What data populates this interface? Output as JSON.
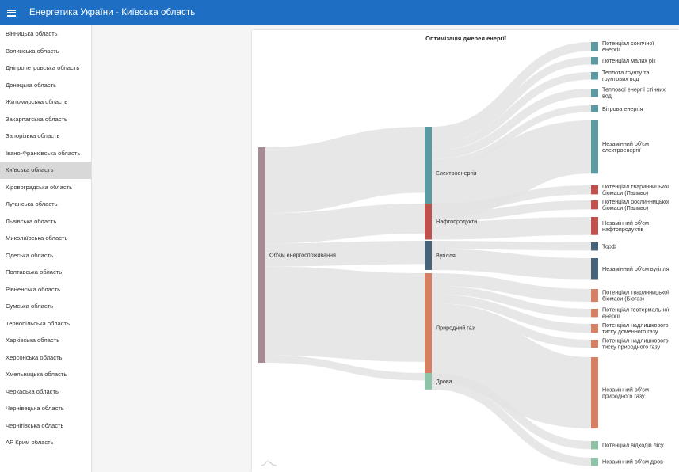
{
  "header": {
    "menu_icon": "hamburger-menu-icon",
    "title": "Енергетика України - Київська область"
  },
  "sidebar": {
    "items": [
      {
        "label": "Вінницька область",
        "active": false
      },
      {
        "label": "Волинська область",
        "active": false
      },
      {
        "label": "Дніпропетровська область",
        "active": false
      },
      {
        "label": "Донецька область",
        "active": false
      },
      {
        "label": "Житомирська область",
        "active": false
      },
      {
        "label": "Закарпатська область",
        "active": false
      },
      {
        "label": "Запорізька область",
        "active": false
      },
      {
        "label": "Івано-Франківська область",
        "active": false
      },
      {
        "label": "Київська область",
        "active": true
      },
      {
        "label": "Кіровоградська область",
        "active": false
      },
      {
        "label": "Луганська область",
        "active": false
      },
      {
        "label": "Львівська область",
        "active": false
      },
      {
        "label": "Миколаївська область",
        "active": false
      },
      {
        "label": "Одеська область",
        "active": false
      },
      {
        "label": "Полтавська область",
        "active": false
      },
      {
        "label": "Рівненська область",
        "active": false
      },
      {
        "label": "Сумська область",
        "active": false
      },
      {
        "label": "Тернопільська область",
        "active": false
      },
      {
        "label": "Харківська область",
        "active": false
      },
      {
        "label": "Херсонська область",
        "active": false
      },
      {
        "label": "Хмельницька область",
        "active": false
      },
      {
        "label": "Черкаська область",
        "active": false
      },
      {
        "label": "Чернівецька область",
        "active": false
      },
      {
        "label": "Чернігівська область",
        "active": false
      },
      {
        "label": "АР Крим область",
        "active": false
      }
    ]
  },
  "chart": {
    "title": "Оптимізація джерел енергії",
    "footer_icon": "wave-icon"
  },
  "colors": {
    "appbar": "#1e6fc4",
    "source": "#a58b93",
    "electricity": "#5b9aa0",
    "oil": "#c0504d",
    "coal": "#46637a",
    "gas": "#d67f62",
    "wood": "#8fc3a8",
    "link": "#e3e3e3"
  },
  "chart_data": {
    "type": "sankey",
    "title": "Оптимізація джерел енергії",
    "nodes": [
      {
        "id": "total",
        "label": "Об'єм енергоспоживання",
        "color": "#a58b93"
      },
      {
        "id": "el",
        "label": "Електроенергія",
        "color": "#5b9aa0"
      },
      {
        "id": "oil",
        "label": "Нафтопродукти",
        "color": "#c0504d"
      },
      {
        "id": "coal",
        "label": "Вугілля",
        "color": "#46637a"
      },
      {
        "id": "gas",
        "label": "Природний газ",
        "color": "#d67f62"
      },
      {
        "id": "wood",
        "label": "Дрова",
        "color": "#8fc3a8"
      },
      {
        "id": "el_sun",
        "label": "Потенціал сонячної енергії",
        "color": "#5b9aa0"
      },
      {
        "id": "el_river",
        "label": "Потенціал малих рік",
        "color": "#5b9aa0"
      },
      {
        "id": "el_ground",
        "label": "Теплота грунту та грунтових вод",
        "color": "#5b9aa0"
      },
      {
        "id": "el_waste",
        "label": "Теплової енергії стічних вод",
        "color": "#5b9aa0"
      },
      {
        "id": "el_wind",
        "label": "Вітрова енергія",
        "color": "#5b9aa0"
      },
      {
        "id": "el_rest",
        "label": "Незамінний об'єм електроенергії",
        "color": "#5b9aa0"
      },
      {
        "id": "oil_animal",
        "label": "Потенціал тваринницької біомаси (Паливо)",
        "color": "#c0504d"
      },
      {
        "id": "oil_plant",
        "label": "Потенціал рослинницької біомаси (Паливо)",
        "color": "#c0504d"
      },
      {
        "id": "oil_rest",
        "label": "Незамінний об'єм нафтопродуктів",
        "color": "#c0504d"
      },
      {
        "id": "coal_peat",
        "label": "Торф",
        "color": "#46637a"
      },
      {
        "id": "coal_rest",
        "label": "Незамінний об'єм вугілля",
        "color": "#46637a"
      },
      {
        "id": "gas_biogas",
        "label": "Потенціал тваринницької біомаси (Біогаз)",
        "color": "#d67f62"
      },
      {
        "id": "gas_geo",
        "label": "Потенціал геотермальної енергії",
        "color": "#d67f62"
      },
      {
        "id": "gas_blast",
        "label": "Потенціал надлишкового тиску доменного газу",
        "color": "#d67f62"
      },
      {
        "id": "gas_natural",
        "label": "Потенціал надлишкового тиску природного газу",
        "color": "#d67f62"
      },
      {
        "id": "gas_rest",
        "label": "Незамінний об'єм природного газу",
        "color": "#d67f62"
      },
      {
        "id": "wood_waste",
        "label": "Потенціал відходів лісу",
        "color": "#8fc3a8"
      },
      {
        "id": "wood_rest",
        "label": "Незамінний об'єм дров",
        "color": "#8fc3a8"
      }
    ],
    "links": [
      {
        "source": "total",
        "target": "el",
        "value": 88
      },
      {
        "source": "total",
        "target": "oil",
        "value": 40
      },
      {
        "source": "total",
        "target": "coal",
        "value": 31
      },
      {
        "source": "total",
        "target": "gas",
        "value": 118
      },
      {
        "source": "total",
        "target": "wood",
        "value": 10
      },
      {
        "source": "el",
        "target": "el_sun",
        "value": 12
      },
      {
        "source": "el",
        "target": "el_river",
        "value": 10
      },
      {
        "source": "el",
        "target": "el_ground",
        "value": 10
      },
      {
        "source": "el",
        "target": "el_waste",
        "value": 11
      },
      {
        "source": "el",
        "target": "el_wind",
        "value": 9
      },
      {
        "source": "el",
        "target": "el_rest",
        "value": 71
      },
      {
        "source": "oil",
        "target": "oil_animal",
        "value": 12
      },
      {
        "source": "oil",
        "target": "oil_plant",
        "value": 12
      },
      {
        "source": "oil",
        "target": "oil_rest",
        "value": 24
      },
      {
        "source": "coal",
        "target": "coal_peat",
        "value": 11
      },
      {
        "source": "coal",
        "target": "coal_rest",
        "value": 28
      },
      {
        "source": "gas",
        "target": "gas_biogas",
        "value": 17
      },
      {
        "source": "gas",
        "target": "gas_geo",
        "value": 11
      },
      {
        "source": "gas",
        "target": "gas_blast",
        "value": 12
      },
      {
        "source": "gas",
        "target": "gas_natural",
        "value": 11
      },
      {
        "source": "gas",
        "target": "gas_rest",
        "value": 95
      },
      {
        "source": "wood",
        "target": "wood_waste",
        "value": 11
      },
      {
        "source": "wood",
        "target": "wood_rest",
        "value": 11
      }
    ]
  }
}
